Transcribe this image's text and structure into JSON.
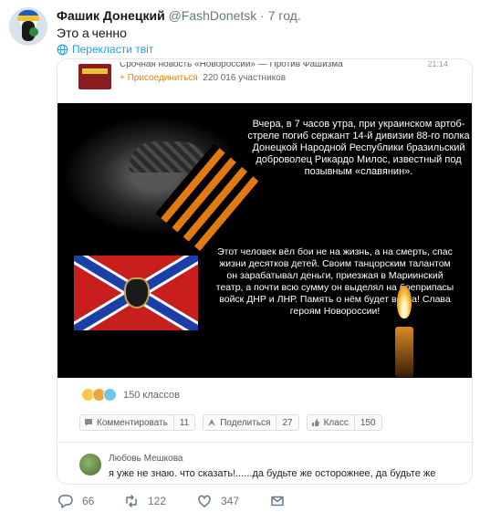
{
  "tweet": {
    "author_name": "Фашик Донецкий",
    "author_handle": "@FashDonetsk",
    "separator": " · ",
    "time": "7 год.",
    "text": "Это а ченно",
    "translate_label": "Перекласти твіт"
  },
  "embed": {
    "group_title": "Срочная новость «Новороссии» — Против Фашизма",
    "join_label": "+ Присоединиться",
    "members": "220 016 участников",
    "time": "21:14",
    "image_text_1": "Вчера, в 7 часов утра, при украинском артоб-стреле погиб сержант 14-й дивизии 88-го полка Донецкой Народной Республики бразильский доброволец Рикардо Милос, известный под позывным «славянин».",
    "image_text_2": "Этот человек вёл бои не на жизнь, а на смерть, спас жизни десятков детей. Своим танцорским талантом он зарабатывал деньги, приезжая в Мариинский театр, а почти всю сумму он выделял на боеприпасы войск ДНР и ЛНР. Память о нём будет вечна! Слава героям Новороссии!",
    "reactions_count": "150 классов",
    "comment_label": "Комментировать",
    "comment_count": "11",
    "share_label": "Поделиться",
    "share_count": "27",
    "class_label": "Класс",
    "class_count": "150",
    "commenter_name": "Любовь Мешкова",
    "comment_text": "я уже не знаю. что сказать!......да будьте же осторожнее, да будьте же"
  },
  "tweet_actions": {
    "replies": "66",
    "retweets": "122",
    "likes": "347"
  },
  "icons": [
    "translate-globe-icon",
    "join-plus-icon",
    "comment-icon",
    "share-icon",
    "class-icon",
    "reply-icon",
    "retweet-icon",
    "like-icon",
    "dm-envelope-icon"
  ]
}
